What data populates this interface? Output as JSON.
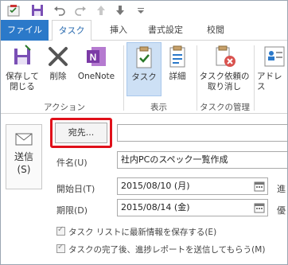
{
  "tabs": [
    {
      "label": "ファイル"
    },
    {
      "label": "タスク"
    },
    {
      "label": "挿入"
    },
    {
      "label": "書式設定"
    },
    {
      "label": "校閲"
    }
  ],
  "ribbon": {
    "save_close": "保存して\n閉じる",
    "save_close_1": "保存して",
    "save_close_2": "閉じる",
    "delete": "削除",
    "onenote": "OneNote",
    "task": "タスク",
    "details": "詳細",
    "cancel_assign_1": "タスク依頼の",
    "cancel_assign_2": "取り消し",
    "address": "アドレス",
    "groups": {
      "action": "アクション",
      "view": "表示",
      "manage": "タスクの管理"
    }
  },
  "form": {
    "send_1": "送信",
    "send_2": "(S)",
    "to_button": "宛先...",
    "subject_label": "件名(U)",
    "subject_value": "社内PCのスペック一覧作成",
    "start_label": "開始日(T)",
    "start_value": "2015/08/10 (月)",
    "due_label": "期限(D)",
    "due_value": "2015/08/14 (金)",
    "right_label_1": "進",
    "right_label_2": "優",
    "check1": "タスク リストに最新情報を保存する(E)",
    "check2": "タスクの完了後、進捗レポートを送信してもらう(M)"
  },
  "colors": {
    "accent": "#2b79c9",
    "highlight": "#e0101a"
  }
}
